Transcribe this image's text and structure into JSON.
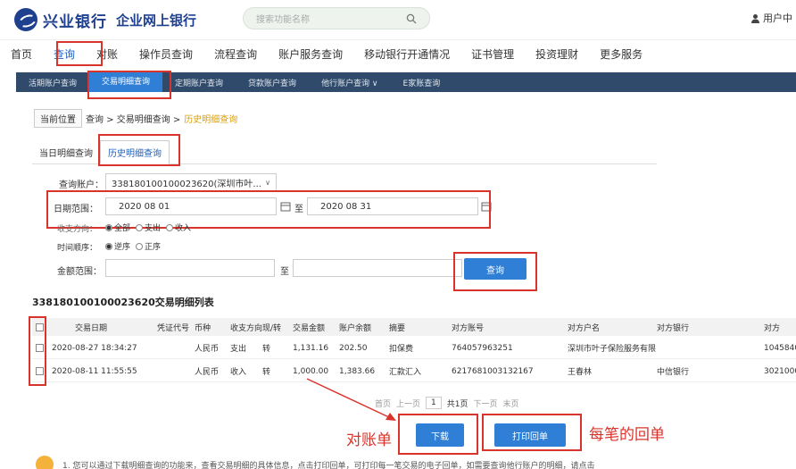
{
  "header": {
    "brand": "兴业银行",
    "brand_sub": "企业网上银行",
    "search_placeholder": "搜索功能名称",
    "user": "用户中"
  },
  "main_nav": [
    "首页",
    "查询",
    "对账",
    "操作员查询",
    "流程查询",
    "账户服务查询",
    "移动银行开通情况",
    "证书管理",
    "投资理财",
    "更多服务"
  ],
  "sub_nav": [
    "活期账户查询",
    "交易明细查询",
    "定期账户查询",
    "贷款账户查询",
    "他行账户查询 ∨",
    "E家账查询"
  ],
  "breadcrumb": {
    "label": "当前位置",
    "path": "查询 > 交易明细查询 > ",
    "last": "历史明细查询"
  },
  "tabs": [
    "当日明细查询",
    "历史明细查询"
  ],
  "form": {
    "account_label": "查询账户：",
    "account_value": "338180100100023620(深圳市叶...",
    "date_label": "日期范围：",
    "date_from": "2020 08 01",
    "date_to_sep": "至",
    "date_to": "2020 08 31",
    "direction_label": "收支方向：",
    "direction_options": [
      "全部",
      "支出",
      "收入"
    ],
    "order_label": "时间顺序：",
    "order_options": [
      "逆序",
      "正序"
    ],
    "amount_label": "金额范围：",
    "amount_sep": "至",
    "query_button": "查询"
  },
  "table": {
    "title": "338180100100023620交易明细列表",
    "columns": [
      "交易日期",
      "凭证代号",
      "币种",
      "收支方向",
      "现/转",
      "交易金额",
      "账户余额",
      "摘要",
      "对方账号",
      "对方户名",
      "对方银行",
      "对方"
    ],
    "rows": [
      [
        "2020-08-27 18:34:27",
        "",
        "人民币",
        "支出",
        "转",
        "1,131.16",
        "202.50",
        "扣保费",
        "764057963251",
        "深圳市叶子保险服务有限",
        "",
        "1045840"
      ],
      [
        "2020-08-11 11:55:55",
        "",
        "人民币",
        "收入",
        "转",
        "1,000.00",
        "1,383.66",
        "汇款汇入",
        "6217681003132167",
        "王春林",
        "中信银行",
        "3021000"
      ]
    ]
  },
  "pager": {
    "first": "首页",
    "prev": "上一页",
    "page": "1",
    "total": "共1页",
    "next": "下一页",
    "last": "末页"
  },
  "actions": {
    "download": "下载",
    "print": "打印回单"
  },
  "notes": {
    "left": "对账单",
    "right": "每笔的回单"
  },
  "tip": "1. 您可以通过下载明细查询的功能来，查看交易明细的具体信息，点击打印回单，可打印每一笔交易的电子回单，如需要查询他行账户的明细，请点击"
}
